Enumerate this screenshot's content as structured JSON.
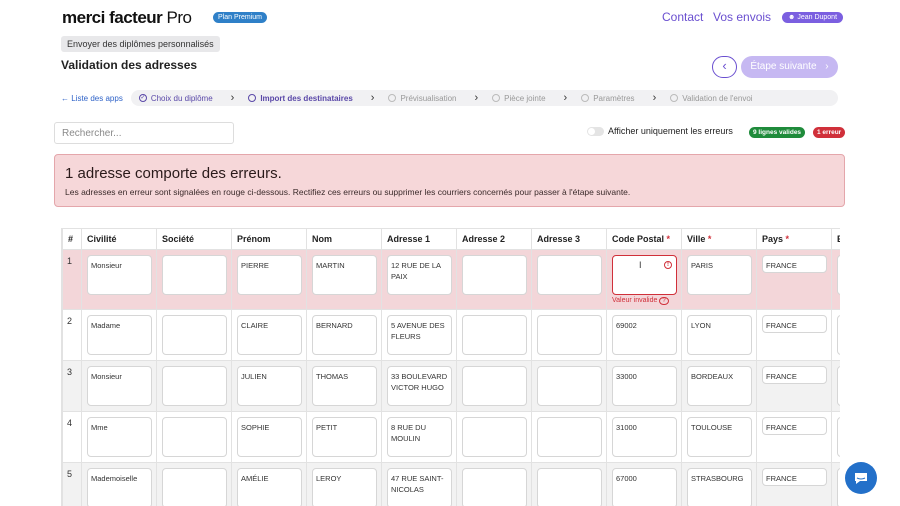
{
  "header": {
    "logo_main": "merci facteur",
    "logo_pro": " Pro",
    "plan_badge": "Plan Premium",
    "nav_contact": "Contact",
    "nav_envois": "Vos envois",
    "user_name": "Jean Dupont"
  },
  "context_chip": "Envoyer des diplômes personnalisés",
  "page_title": "Validation des adresses",
  "next_button": "Étape suivante",
  "stepper": {
    "apps_link": "Liste des apps",
    "steps": [
      {
        "label": "Choix du diplôme",
        "state": "done"
      },
      {
        "label": "Import des destinataires",
        "state": "active"
      },
      {
        "label": "Prévisualisation",
        "state": "todo"
      },
      {
        "label": "Pièce jointe",
        "state": "todo"
      },
      {
        "label": "Paramètres",
        "state": "todo"
      },
      {
        "label": "Validation de l'envoi",
        "state": "todo"
      }
    ]
  },
  "search": {
    "placeholder": "Rechercher..."
  },
  "filter": {
    "label": "Afficher uniquement les erreurs",
    "enabled": false
  },
  "badges": {
    "valid": "9 lignes valides",
    "error": "1 erreur"
  },
  "alert": {
    "title": "1 adresse comporte des erreurs.",
    "text": "Les adresses en erreur sont signalées en rouge ci-dessous. Rectifiez ces erreurs ou supprimer les courriers concernés pour passer à l'étape suivante."
  },
  "table": {
    "columns": [
      "#",
      "Civilité",
      "Société",
      "Prénom",
      "Nom",
      "Adresse 1",
      "Adresse 2",
      "Adresse 3",
      "Code Postal",
      "Ville",
      "Pays",
      "E"
    ],
    "required_columns": [
      "Code Postal",
      "Ville",
      "Pays"
    ],
    "error_message": "Valeur invalide",
    "rows": [
      {
        "num": "1",
        "civilite": "Monsieur",
        "societe": "",
        "prenom": "PIERRE",
        "nom": "MARTIN",
        "adresse1": "12 RUE DE LA PAIX",
        "adresse2": "",
        "adresse3": "",
        "cp": "",
        "ville": "PARIS",
        "pays": "FRANCE",
        "error": true
      },
      {
        "num": "2",
        "civilite": "Madame",
        "societe": "",
        "prenom": "CLAIRE",
        "nom": "BERNARD",
        "adresse1": "5 AVENUE DES FLEURS",
        "adresse2": "",
        "adresse3": "",
        "cp": "69002",
        "ville": "LYON",
        "pays": "FRANCE",
        "error": false
      },
      {
        "num": "3",
        "civilite": "Monsieur",
        "societe": "",
        "prenom": "JULIEN",
        "nom": "THOMAS",
        "adresse1": "33 BOULEVARD VICTOR HUGO",
        "adresse2": "",
        "adresse3": "",
        "cp": "33000",
        "ville": "BORDEAUX",
        "pays": "FRANCE",
        "error": false
      },
      {
        "num": "4",
        "civilite": "Mme",
        "societe": "",
        "prenom": "SOPHIE",
        "nom": "PETIT",
        "adresse1": "8 RUE DU MOULIN",
        "adresse2": "",
        "adresse3": "",
        "cp": "31000",
        "ville": "TOULOUSE",
        "pays": "FRANCE",
        "error": false
      },
      {
        "num": "5",
        "civilite": "Mademoiselle",
        "societe": "",
        "prenom": "AMÉLIE",
        "nom": "LEROY",
        "adresse1": "47 RUE SAINT-NICOLAS",
        "adresse2": "",
        "adresse3": "",
        "cp": "67000",
        "ville": "STRASBOURG",
        "pays": "FRANCE",
        "error": false
      }
    ]
  },
  "colors": {
    "accent": "#6a4fd0",
    "error": "#d0303a",
    "valid": "#1f8b3b",
    "chat": "#2370c9"
  }
}
